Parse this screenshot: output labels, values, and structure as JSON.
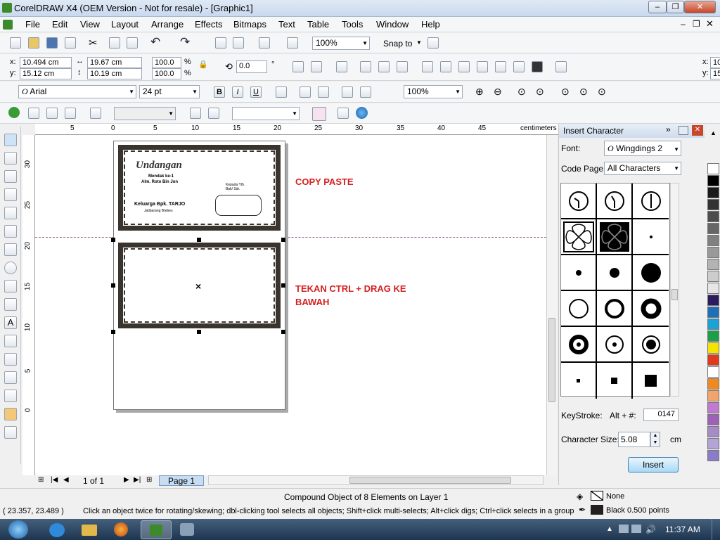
{
  "window": {
    "title": "CorelDRAW X4 (OEM Version - Not for resale) - [Graphic1]",
    "minimize": "–",
    "restore": "❐",
    "close": "✕"
  },
  "menu": [
    "File",
    "Edit",
    "View",
    "Layout",
    "Arrange",
    "Effects",
    "Bitmaps",
    "Text",
    "Table",
    "Tools",
    "Window",
    "Help"
  ],
  "standard_toolbar": {
    "zoom": "100%",
    "snap_to": "Snap to"
  },
  "property_bar": {
    "x": "10.494 cm",
    "y": "15.12 cm",
    "width": "19.67 cm",
    "height": "10.19 cm",
    "scale_w": "100.0",
    "scale_h": "100.0",
    "pct": "%",
    "rotation": "0.0",
    "deg": "°",
    "x_label": "x:",
    "y_label": "y:",
    "x_right": "10",
    "y_right": "15"
  },
  "text_toolbar": {
    "font": "Arial",
    "size": "24 pt",
    "zoom": "100%"
  },
  "rulers": {
    "unit": "centimeters",
    "h_ticks": [
      "5",
      "0",
      "5",
      "10",
      "15",
      "20",
      "25",
      "30",
      "35",
      "40",
      "45"
    ],
    "v_ticks": [
      "30",
      "25",
      "20",
      "15",
      "10",
      "5",
      "0"
    ]
  },
  "card_top": {
    "title": "Undangan",
    "line1": "Mendak ke-1",
    "line2": "Alm. Roto Bin Jon",
    "to1": "Kepada Yth.",
    "to2": "Bpk/ Sdr.",
    "from1": "Keluarga Bpk. TARJO",
    "from2": "Jatibarang Brebes"
  },
  "annotations": {
    "copy": "COPY PASTE",
    "drag": "TEKAN CTRL + DRAG KE BAWAH"
  },
  "page_nav": {
    "count": "1 of 1",
    "tab": "Page 1"
  },
  "docker": {
    "title": "Insert Character",
    "font_label": "Font:",
    "font": "Wingdings 2",
    "codepage_label": "Code Page:",
    "codepage": "All Characters",
    "keystroke_label": "KeyStroke:",
    "keystroke_mid": "Alt + #:",
    "keystroke": "0147",
    "size_label": "Character Size:",
    "size": "5.08",
    "unit": "cm",
    "insert": "Insert"
  },
  "status": {
    "object": "Compound Object of 8 Elements on Layer 1",
    "coords": "( 23.357, 23.489 )",
    "hint": "Click an object twice for rotating/skewing; dbl-clicking tool selects all objects; Shift+click multi-selects; Alt+click digs; Ctrl+click selects in a group",
    "fill": "None",
    "outline": "Black  0.500 points"
  },
  "taskbar": {
    "clock": "11:37 AM"
  },
  "palette": [
    "#ffffff",
    "#000000",
    "#1a1a1a",
    "#333333",
    "#4d4d4d",
    "#666666",
    "#808080",
    "#999999",
    "#b3b3b3",
    "#cccccc",
    "#e6e6e6",
    "#2e1a5e",
    "#1e6fb8",
    "#1aa1d6",
    "#1e9e4a",
    "#f5e400",
    "#e03a1e",
    "#ffffff",
    "#f08a1e",
    "#f4a46a",
    "#c07bd0",
    "#9d62b8",
    "#a78bc9",
    "#b4a3d6",
    "#8b7cc7"
  ]
}
